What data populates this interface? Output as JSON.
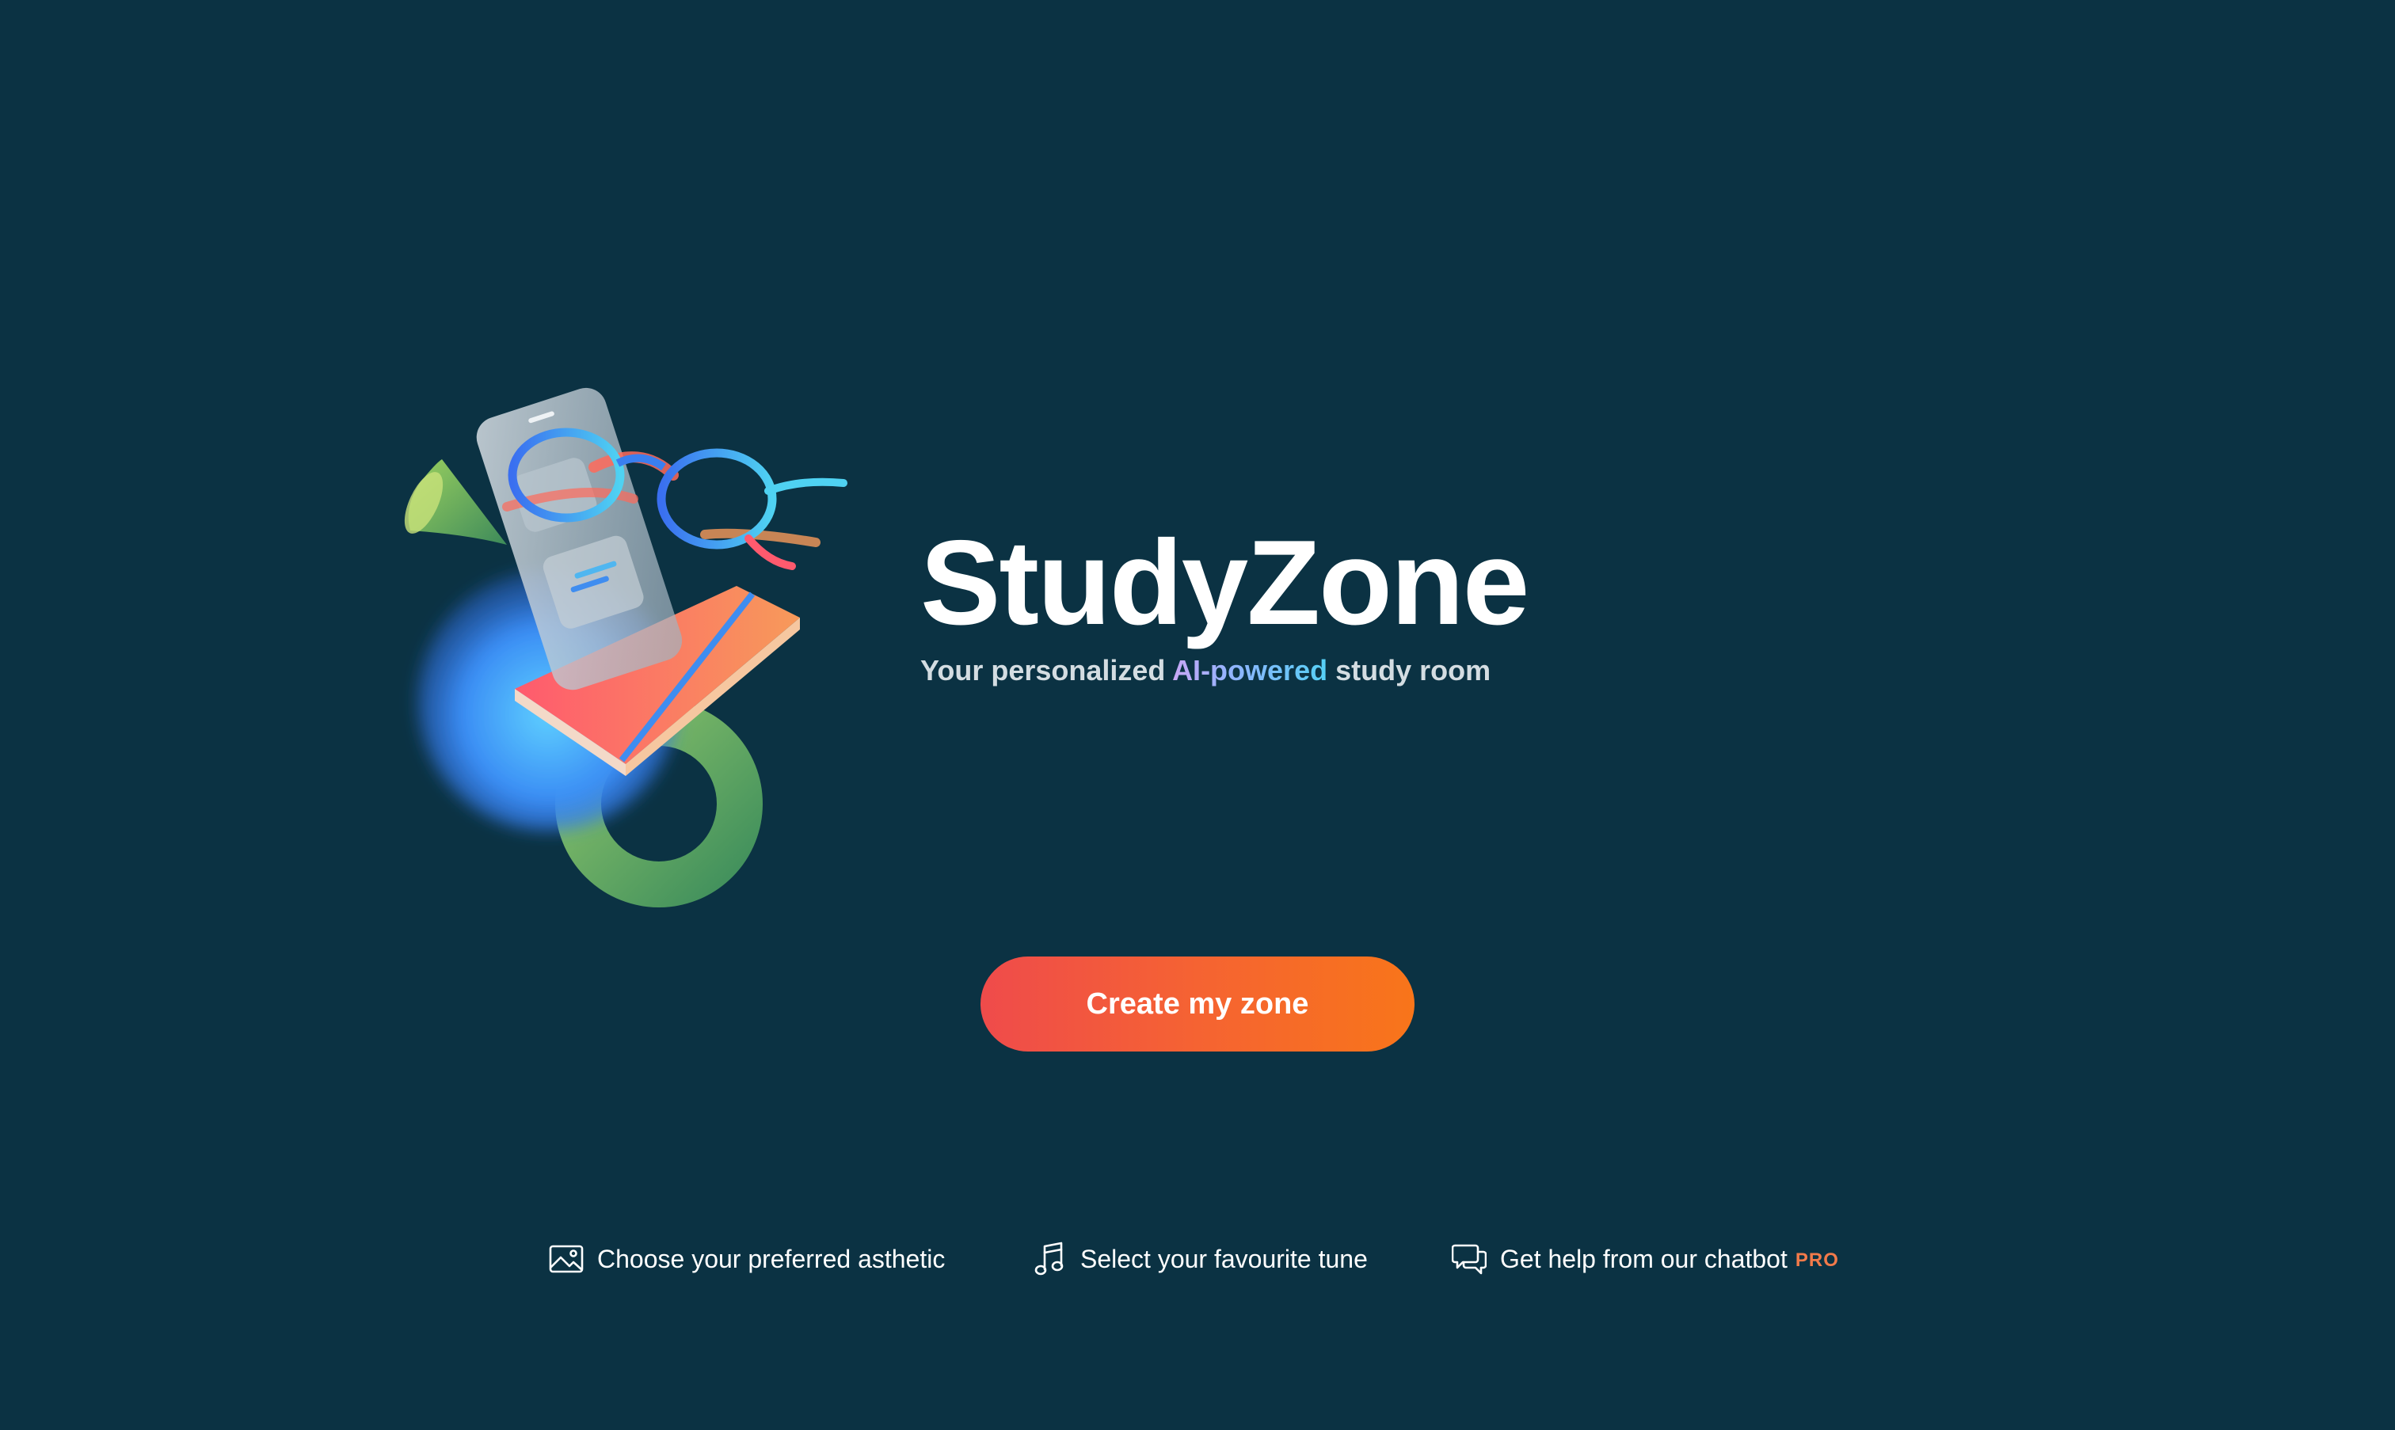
{
  "brand": {
    "title": "StudyZone",
    "tagline_before": "Your personalized ",
    "tagline_accent": "AI-powered",
    "tagline_after": " study room"
  },
  "cta": {
    "label": "Create my zone"
  },
  "features": [
    {
      "label": "Choose your preferred asthetic",
      "icon": "image-icon"
    },
    {
      "label": "Select your favourite tune",
      "icon": "music-note-icon"
    },
    {
      "label": "Get help from our chatbot",
      "icon": "chat-bubbles-icon",
      "badge": "PRO"
    }
  ],
  "colors": {
    "background": "#0b3243",
    "cta_gradient_start": "#ef4b4b",
    "cta_gradient_end": "#f8751a",
    "pro_badge": "#f27a4a",
    "accent_gradient": [
      "#c8a7f5",
      "#8fb4ff",
      "#55d0f5"
    ]
  }
}
